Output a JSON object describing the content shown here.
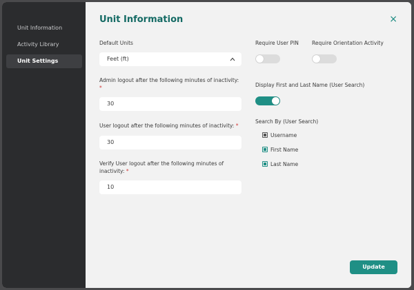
{
  "sidebar": {
    "items": [
      {
        "label": "Unit Information"
      },
      {
        "label": "Activity Library"
      },
      {
        "label": "Unit Settings"
      }
    ]
  },
  "main": {
    "title": "Unit Information",
    "close_symbol": "×",
    "default_units": {
      "label": "Default Units",
      "value": "Feet (ft)"
    },
    "admin_logout": {
      "label": "Admin logout after the following minutes of inactivity:",
      "required": "*",
      "value": "30"
    },
    "user_logout": {
      "label": "User logout after the following minutes of inactivity:",
      "required": "*",
      "value": "30"
    },
    "verify_logout": {
      "label": "Verify User logout after the following minutes of inactivity:",
      "required": "*",
      "value": "10"
    },
    "require_pin": {
      "label": "Require User PIN",
      "enabled": false
    },
    "require_orientation": {
      "label": "Require Orientation Activity",
      "enabled": false
    },
    "display_names": {
      "label": "Display First and Last Name (User Search)",
      "enabled": true
    },
    "search_by": {
      "label": "Search By (User Search)",
      "options": [
        {
          "label": "Username",
          "checked": true
        },
        {
          "label": "First Name",
          "checked": true
        },
        {
          "label": "Last Name",
          "checked": true
        }
      ]
    },
    "update_label": "Update"
  },
  "colors": {
    "accent": "#1f8f85",
    "title": "#146a64",
    "sidebar_bg": "#2b2c2e",
    "required": "#d23b3b"
  },
  "icons": {
    "close": "close-icon",
    "chevron": "chevron-up-icon"
  }
}
